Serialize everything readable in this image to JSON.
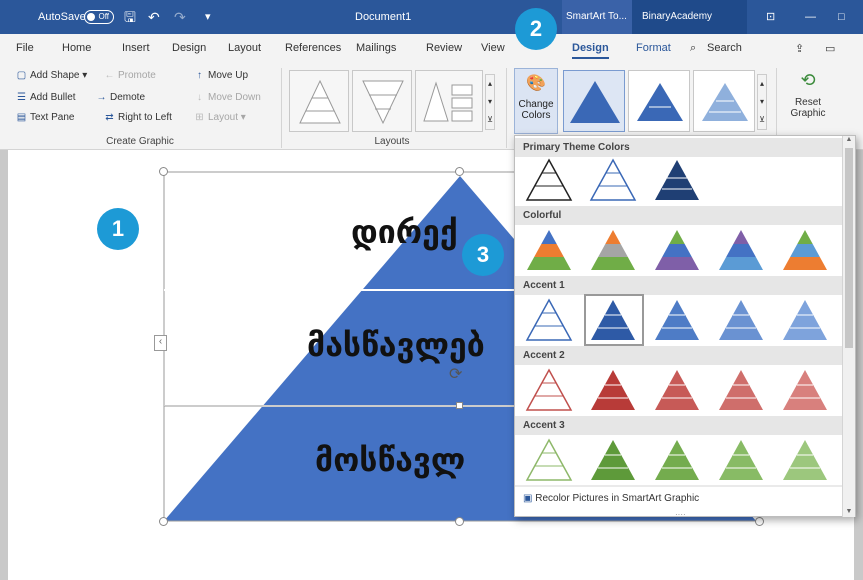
{
  "titlebar": {
    "autosave": "AutoSave",
    "toggle": "Off",
    "document": "Document1",
    "context_tab": "SmartArt To...",
    "user": "BinaryAcademy"
  },
  "tabs": [
    "File",
    "Home",
    "Insert",
    "Design",
    "Layout",
    "References",
    "Mailings",
    "Review",
    "View",
    "Design",
    "Format",
    "Search"
  ],
  "create_graphic": {
    "add_shape": "Add Shape",
    "add_bullet": "Add Bullet",
    "text_pane": "Text Pane",
    "promote": "Promote",
    "demote": "Demote",
    "right_to_left": "Right to Left",
    "move_up": "Move Up",
    "move_down": "Move Down",
    "layout": "Layout",
    "group_label": "Create Graphic"
  },
  "layouts_group": "Layouts",
  "change_colors": [
    "Change",
    "Colors"
  ],
  "reset_graphic": [
    "Reset",
    "Graphic"
  ],
  "gallery": {
    "sections": [
      "Primary Theme Colors",
      "Colorful",
      "Accent 1",
      "Accent 2",
      "Accent 3"
    ],
    "recolor": "Recolor Pictures in SmartArt Graphic"
  },
  "smartart": {
    "lines": [
      "დირექ",
      "მასწავლებ",
      "მოსწავლ"
    ]
  },
  "badges": [
    "1",
    "2",
    "3"
  ],
  "colors": {
    "accent": "#2b579a",
    "pyramid": "#4472c4",
    "badge": "#1d9ad6"
  }
}
